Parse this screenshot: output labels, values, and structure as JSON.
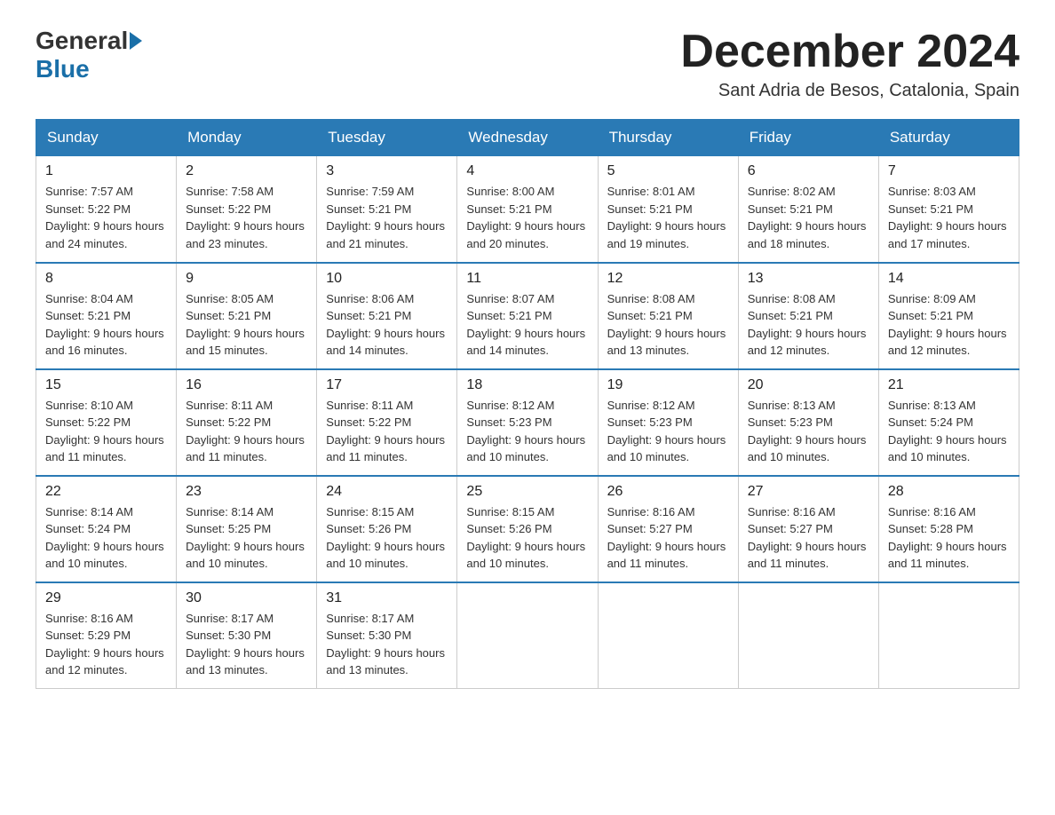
{
  "header": {
    "logo_general": "General",
    "logo_blue": "Blue",
    "month_title": "December 2024",
    "location": "Sant Adria de Besos, Catalonia, Spain"
  },
  "days_of_week": [
    "Sunday",
    "Monday",
    "Tuesday",
    "Wednesday",
    "Thursday",
    "Friday",
    "Saturday"
  ],
  "weeks": [
    [
      {
        "day": "1",
        "sunrise": "7:57 AM",
        "sunset": "5:22 PM",
        "daylight": "9 hours and 24 minutes."
      },
      {
        "day": "2",
        "sunrise": "7:58 AM",
        "sunset": "5:22 PM",
        "daylight": "9 hours and 23 minutes."
      },
      {
        "day": "3",
        "sunrise": "7:59 AM",
        "sunset": "5:21 PM",
        "daylight": "9 hours and 21 minutes."
      },
      {
        "day": "4",
        "sunrise": "8:00 AM",
        "sunset": "5:21 PM",
        "daylight": "9 hours and 20 minutes."
      },
      {
        "day": "5",
        "sunrise": "8:01 AM",
        "sunset": "5:21 PM",
        "daylight": "9 hours and 19 minutes."
      },
      {
        "day": "6",
        "sunrise": "8:02 AM",
        "sunset": "5:21 PM",
        "daylight": "9 hours and 18 minutes."
      },
      {
        "day": "7",
        "sunrise": "8:03 AM",
        "sunset": "5:21 PM",
        "daylight": "9 hours and 17 minutes."
      }
    ],
    [
      {
        "day": "8",
        "sunrise": "8:04 AM",
        "sunset": "5:21 PM",
        "daylight": "9 hours and 16 minutes."
      },
      {
        "day": "9",
        "sunrise": "8:05 AM",
        "sunset": "5:21 PM",
        "daylight": "9 hours and 15 minutes."
      },
      {
        "day": "10",
        "sunrise": "8:06 AM",
        "sunset": "5:21 PM",
        "daylight": "9 hours and 14 minutes."
      },
      {
        "day": "11",
        "sunrise": "8:07 AM",
        "sunset": "5:21 PM",
        "daylight": "9 hours and 14 minutes."
      },
      {
        "day": "12",
        "sunrise": "8:08 AM",
        "sunset": "5:21 PM",
        "daylight": "9 hours and 13 minutes."
      },
      {
        "day": "13",
        "sunrise": "8:08 AM",
        "sunset": "5:21 PM",
        "daylight": "9 hours and 12 minutes."
      },
      {
        "day": "14",
        "sunrise": "8:09 AM",
        "sunset": "5:21 PM",
        "daylight": "9 hours and 12 minutes."
      }
    ],
    [
      {
        "day": "15",
        "sunrise": "8:10 AM",
        "sunset": "5:22 PM",
        "daylight": "9 hours and 11 minutes."
      },
      {
        "day": "16",
        "sunrise": "8:11 AM",
        "sunset": "5:22 PM",
        "daylight": "9 hours and 11 minutes."
      },
      {
        "day": "17",
        "sunrise": "8:11 AM",
        "sunset": "5:22 PM",
        "daylight": "9 hours and 11 minutes."
      },
      {
        "day": "18",
        "sunrise": "8:12 AM",
        "sunset": "5:23 PM",
        "daylight": "9 hours and 10 minutes."
      },
      {
        "day": "19",
        "sunrise": "8:12 AM",
        "sunset": "5:23 PM",
        "daylight": "9 hours and 10 minutes."
      },
      {
        "day": "20",
        "sunrise": "8:13 AM",
        "sunset": "5:23 PM",
        "daylight": "9 hours and 10 minutes."
      },
      {
        "day": "21",
        "sunrise": "8:13 AM",
        "sunset": "5:24 PM",
        "daylight": "9 hours and 10 minutes."
      }
    ],
    [
      {
        "day": "22",
        "sunrise": "8:14 AM",
        "sunset": "5:24 PM",
        "daylight": "9 hours and 10 minutes."
      },
      {
        "day": "23",
        "sunrise": "8:14 AM",
        "sunset": "5:25 PM",
        "daylight": "9 hours and 10 minutes."
      },
      {
        "day": "24",
        "sunrise": "8:15 AM",
        "sunset": "5:26 PM",
        "daylight": "9 hours and 10 minutes."
      },
      {
        "day": "25",
        "sunrise": "8:15 AM",
        "sunset": "5:26 PM",
        "daylight": "9 hours and 10 minutes."
      },
      {
        "day": "26",
        "sunrise": "8:16 AM",
        "sunset": "5:27 PM",
        "daylight": "9 hours and 11 minutes."
      },
      {
        "day": "27",
        "sunrise": "8:16 AM",
        "sunset": "5:27 PM",
        "daylight": "9 hours and 11 minutes."
      },
      {
        "day": "28",
        "sunrise": "8:16 AM",
        "sunset": "5:28 PM",
        "daylight": "9 hours and 11 minutes."
      }
    ],
    [
      {
        "day": "29",
        "sunrise": "8:16 AM",
        "sunset": "5:29 PM",
        "daylight": "9 hours and 12 minutes."
      },
      {
        "day": "30",
        "sunrise": "8:17 AM",
        "sunset": "5:30 PM",
        "daylight": "9 hours and 13 minutes."
      },
      {
        "day": "31",
        "sunrise": "8:17 AM",
        "sunset": "5:30 PM",
        "daylight": "9 hours and 13 minutes."
      },
      null,
      null,
      null,
      null
    ]
  ],
  "labels": {
    "sunrise": "Sunrise:",
    "sunset": "Sunset:",
    "daylight": "Daylight:"
  }
}
